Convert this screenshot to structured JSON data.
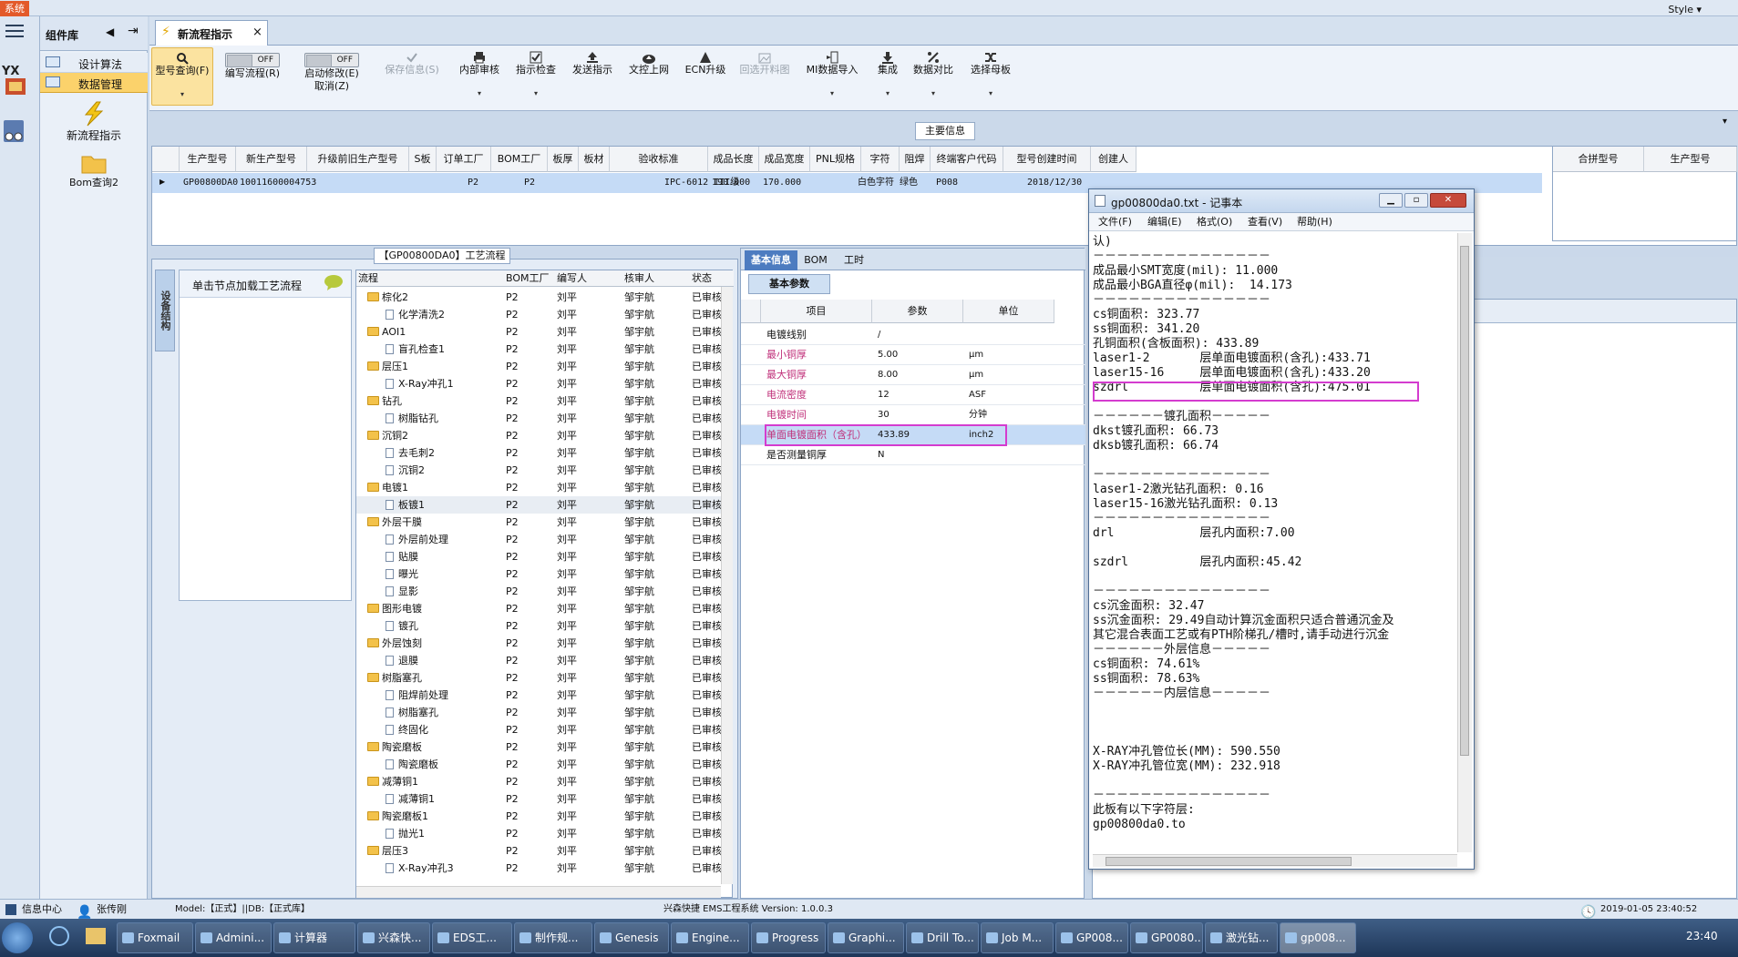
{
  "top": {
    "system_badge": "系统",
    "style_label": "Style ▾"
  },
  "left_toolbar": {
    "title": "组件库",
    "items": [
      "设计算法",
      "数据管理"
    ],
    "tools": [
      "新流程指示",
      "Bom查询2"
    ]
  },
  "tabs": {
    "active": "新流程指示",
    "close": "×"
  },
  "ribbon": {
    "buttons": [
      {
        "label": "型号查询(F)",
        "icon": "search-icon",
        "enabled": true
      },
      {
        "label": "编写流程(R)",
        "toggle": "OFF",
        "enabled": true
      },
      {
        "label": "启动修改(E)",
        "sub": "取消(Z)",
        "toggle": "OFF",
        "enabled": true
      },
      {
        "label": "保存信息(S)",
        "icon": "check-icon",
        "enabled": false
      },
      {
        "label": "内部审核",
        "icon": "printer-icon",
        "enabled": true
      },
      {
        "label": "指示检查",
        "icon": "checklist-icon",
        "enabled": true
      },
      {
        "label": "发送指示",
        "icon": "upload-icon",
        "enabled": true
      },
      {
        "label": "文控上网",
        "icon": "cloud-upload-icon",
        "enabled": true
      },
      {
        "label": "ECN升级",
        "icon": "ecn-icon",
        "enabled": true
      },
      {
        "label": "回选开料图",
        "icon": "image-icon",
        "enabled": false
      },
      {
        "label": "MI数据导入",
        "icon": "import-icon",
        "enabled": true
      },
      {
        "label": "集成",
        "icon": "download-icon",
        "enabled": true
      },
      {
        "label": "数据对比",
        "icon": "compare-icon",
        "enabled": true
      },
      {
        "label": "选择母板",
        "icon": "shuffle-icon",
        "enabled": true
      }
    ],
    "main_info_label": "主要信息"
  },
  "top_grid": {
    "headers": [
      "生产型号",
      "新生产型号",
      "升级前旧生产型号",
      "S板",
      "订单工厂",
      "BOM工厂",
      "板厚",
      "板材",
      "验收标准",
      "成品长度",
      "成品宽度",
      "PNL规格",
      "字符",
      "阻焊",
      "终端客户代码",
      "型号创建时间",
      "创建人"
    ],
    "row": [
      "GP00800DA0",
      "10011600004753",
      "",
      "",
      "P2",
      "P2",
      "",
      "",
      "IPC-6012 III级",
      "190.000",
      "170.000",
      "",
      "白色字符",
      "绿色",
      "P008",
      "2018/12/30",
      ""
    ],
    "right_headers": [
      "合拼型号",
      "生产型号"
    ]
  },
  "flow": {
    "title": "【GP00800DA0】工艺流程",
    "vertical_tab": "设备结构",
    "click_hint": "单击节点加载工艺流程",
    "headers": [
      "流程",
      "BOM工厂",
      "编写人",
      "核审人",
      "状态"
    ],
    "rows": [
      {
        "name": "棕化2",
        "folder": true,
        "bom": "P2",
        "writer": "刘平",
        "reviewer": "邹宇航",
        "status": "已审核"
      },
      {
        "name": "化学清洗2",
        "folder": false,
        "bom": "P2",
        "writer": "刘平",
        "reviewer": "邹宇航",
        "status": "已审核"
      },
      {
        "name": "AOI1",
        "folder": true,
        "bom": "P2",
        "writer": "刘平",
        "reviewer": "邹宇航",
        "status": "已审核"
      },
      {
        "name": "盲孔检查1",
        "folder": false,
        "bom": "P2",
        "writer": "刘平",
        "reviewer": "邹宇航",
        "status": "已审核"
      },
      {
        "name": "层压1",
        "folder": true,
        "bom": "P2",
        "writer": "刘平",
        "reviewer": "邹宇航",
        "status": "已审核"
      },
      {
        "name": "X-Ray冲孔1",
        "folder": false,
        "bom": "P2",
        "writer": "刘平",
        "reviewer": "邹宇航",
        "status": "已审核"
      },
      {
        "name": "钻孔",
        "folder": true,
        "bom": "P2",
        "writer": "刘平",
        "reviewer": "邹宇航",
        "status": "已审核"
      },
      {
        "name": "树脂钻孔",
        "folder": false,
        "bom": "P2",
        "writer": "刘平",
        "reviewer": "邹宇航",
        "status": "已审核"
      },
      {
        "name": "沉铜2",
        "folder": true,
        "bom": "P2",
        "writer": "刘平",
        "reviewer": "邹宇航",
        "status": "已审核"
      },
      {
        "name": "去毛刺2",
        "folder": false,
        "bom": "P2",
        "writer": "刘平",
        "reviewer": "邹宇航",
        "status": "已审核"
      },
      {
        "name": "沉铜2",
        "folder": false,
        "bom": "P2",
        "writer": "刘平",
        "reviewer": "邹宇航",
        "status": "已审核"
      },
      {
        "name": "电镀1",
        "folder": true,
        "bom": "P2",
        "writer": "刘平",
        "reviewer": "邹宇航",
        "status": "已审核"
      },
      {
        "name": "板镀1",
        "folder": false,
        "bom": "P2",
        "writer": "刘平",
        "reviewer": "邹宇航",
        "status": "已审核"
      },
      {
        "name": "外层干膜",
        "folder": true,
        "bom": "P2",
        "writer": "刘平",
        "reviewer": "邹宇航",
        "status": "已审核"
      },
      {
        "name": "外层前处理",
        "folder": false,
        "bom": "P2",
        "writer": "刘平",
        "reviewer": "邹宇航",
        "status": "已审核"
      },
      {
        "name": "贴膜",
        "folder": false,
        "bom": "P2",
        "writer": "刘平",
        "reviewer": "邹宇航",
        "status": "已审核"
      },
      {
        "name": "曝光",
        "folder": false,
        "bom": "P2",
        "writer": "刘平",
        "reviewer": "邹宇航",
        "status": "已审核"
      },
      {
        "name": "显影",
        "folder": false,
        "bom": "P2",
        "writer": "刘平",
        "reviewer": "邹宇航",
        "status": "已审核"
      },
      {
        "name": "图形电镀",
        "folder": true,
        "bom": "P2",
        "writer": "刘平",
        "reviewer": "邹宇航",
        "status": "已审核"
      },
      {
        "name": "镀孔",
        "folder": false,
        "bom": "P2",
        "writer": "刘平",
        "reviewer": "邹宇航",
        "status": "已审核"
      },
      {
        "name": "外层蚀刻",
        "folder": true,
        "bom": "P2",
        "writer": "刘平",
        "reviewer": "邹宇航",
        "status": "已审核"
      },
      {
        "name": "退膜",
        "folder": false,
        "bom": "P2",
        "writer": "刘平",
        "reviewer": "邹宇航",
        "status": "已审核"
      },
      {
        "name": "树脂塞孔",
        "folder": true,
        "bom": "P2",
        "writer": "刘平",
        "reviewer": "邹宇航",
        "status": "已审核"
      },
      {
        "name": "阻焊前处理",
        "folder": false,
        "bom": "P2",
        "writer": "刘平",
        "reviewer": "邹宇航",
        "status": "已审核"
      },
      {
        "name": "树脂塞孔",
        "folder": false,
        "bom": "P2",
        "writer": "刘平",
        "reviewer": "邹宇航",
        "status": "已审核"
      },
      {
        "name": "终固化",
        "folder": false,
        "bom": "P2",
        "writer": "刘平",
        "reviewer": "邹宇航",
        "status": "已审核"
      },
      {
        "name": "陶瓷磨板",
        "folder": true,
        "bom": "P2",
        "writer": "刘平",
        "reviewer": "邹宇航",
        "status": "已审核"
      },
      {
        "name": "陶瓷磨板",
        "folder": false,
        "bom": "P2",
        "writer": "刘平",
        "reviewer": "邹宇航",
        "status": "已审核"
      },
      {
        "name": "减薄铜1",
        "folder": true,
        "bom": "P2",
        "writer": "刘平",
        "reviewer": "邹宇航",
        "status": "已审核"
      },
      {
        "name": "减薄铜1",
        "folder": false,
        "bom": "P2",
        "writer": "刘平",
        "reviewer": "邹宇航",
        "status": "已审核"
      },
      {
        "name": "陶瓷磨板1",
        "folder": true,
        "bom": "P2",
        "writer": "刘平",
        "reviewer": "邹宇航",
        "status": "已审核"
      },
      {
        "name": "抛光1",
        "folder": false,
        "bom": "P2",
        "writer": "刘平",
        "reviewer": "邹宇航",
        "status": "已审核"
      },
      {
        "name": "层压3",
        "folder": true,
        "bom": "P2",
        "writer": "刘平",
        "reviewer": "邹宇航",
        "status": "已审核"
      },
      {
        "name": "X-Ray冲孔3",
        "folder": false,
        "bom": "P2",
        "writer": "刘平",
        "reviewer": "邹宇航",
        "status": "已审核"
      }
    ]
  },
  "info": {
    "tabs": [
      "基本信息",
      "BOM",
      "工时"
    ],
    "subtab": "基本参数",
    "headers": [
      "项目",
      "参数",
      "单位"
    ],
    "rows": [
      {
        "item": "电镀线别",
        "value": "/",
        "unit": ""
      },
      {
        "item": "最小铜厚",
        "value": "5.00",
        "unit": "μm"
      },
      {
        "item": "最大铜厚",
        "value": "8.00",
        "unit": "μm"
      },
      {
        "item": "电流密度",
        "value": "12",
        "unit": "ASF"
      },
      {
        "item": "电镀时间",
        "value": "30",
        "unit": "分钟"
      },
      {
        "item": "单面电镀面积（含孔）",
        "value": "433.89",
        "unit": "inch2"
      },
      {
        "item": "是否测量铜厚",
        "value": "N",
        "unit": ""
      }
    ]
  },
  "notepad": {
    "title": "gp00800da0.txt - 记事本",
    "menu": [
      "文件(F)",
      "编辑(E)",
      "格式(O)",
      "查看(V)",
      "帮助(H)"
    ],
    "lines": [
      "认)",
      "－－－－－－－－－－－－－－－",
      "成品最小SMT宽度(mil): 11.000",
      "成品最小BGA直径φ(mil):  14.173",
      "－－－－－－－－－－－－－－－",
      "cs铜面积: 323.77",
      "ss铜面积: 341.20",
      "孔铜面积(含板面积): 433.89",
      "laser1-2       层单面电镀面积(含孔):433.71",
      "laser15-16     层单面电镀面积(含孔):433.20",
      "szdrl          层单面电镀面积(含孔):475.01",
      "",
      "－－－－－－镀孔面积－－－－－",
      "dkst镀孔面积: 66.73",
      "dksb镀孔面积: 66.74",
      "",
      "－－－－－－－－－－－－－－－",
      "laser1-2激光钻孔面积: 0.16",
      "laser15-16激光钻孔面积: 0.13",
      "－－－－－－－－－－－－－－－",
      "drl            层孔内面积:7.00",
      "",
      "szdrl          层孔内面积:45.42",
      "",
      "－－－－－－－－－－－－－－－",
      "cs沉金面积: 32.47",
      "ss沉金面积: 29.49自动计算沉金面积只适合普通沉金及",
      "其它混合表面工艺或有PTH阶梯孔/槽时,请手动进行沉金",
      "－－－－－－外层信息－－－－－",
      "cs铜面积: 74.61%",
      "ss铜面积: 78.63%",
      "－－－－－－内层信息－－－－－",
      "",
      "",
      "",
      "X-RAY冲孔管位长(MM): 590.550",
      "X-RAY冲孔管位宽(MM): 232.918",
      "",
      "－－－－－－－－－－－－－－－",
      "此板有以下字符层:",
      "gp00800da0.to"
    ]
  },
  "status": {
    "info_center": "信息中心",
    "user": "张传刚",
    "model": "Model:【正式】||DB:【正式库】",
    "system": "兴森快捷 EMS工程系统 Version: 1.0.0.3",
    "datetime": "2019-01-05 23:40:52"
  },
  "taskbar": {
    "items": [
      "Foxmail",
      "Admini...",
      "计算器",
      "兴森快...",
      "EDS工...",
      "制作规...",
      "Genesis",
      "Engine...",
      "Progress",
      "Graphi...",
      "Drill To...",
      "Job M...",
      "GP008...",
      "GP0080...",
      "激光钻...",
      "gp008..."
    ],
    "clock": "23:40"
  }
}
